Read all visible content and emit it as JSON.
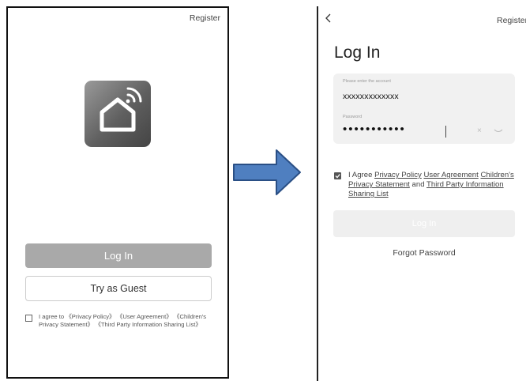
{
  "left_screen": {
    "register_label": "Register",
    "app_icon": "smart-home-icon",
    "login_button": "Log In",
    "guest_button": "Try as Guest",
    "agreement_text": "I agree to 《Privacy Policy》 《User Agreement》 《Children's Privacy Statement》 《Third Party Information Sharing List》",
    "agreement_checked": false
  },
  "arrow": {
    "icon": "right-arrow-icon",
    "fill_color": "#4f7fc0",
    "stroke_color": "#2a4f85"
  },
  "right_screen": {
    "back_icon": "chevron-left-icon",
    "register_label": "Register",
    "title": "Log In",
    "account_label": "Please enter the account",
    "account_value": "xxxxxxxxxxxxx",
    "password_label": "Password",
    "password_value": "•••••••••••",
    "clear_icon": "×",
    "eye_icon": "eye-closed-icon",
    "agreement_checked": true,
    "agreement": {
      "prefix": "I Agree",
      "privacy_policy": "Privacy Policy",
      "user_agreement": "User Agreement",
      "children_privacy": "Children's Privacy Statement",
      "and": "and",
      "third_party": "Third Party Information Sharing List"
    },
    "login_button": "Log In",
    "forgot_password": "Forgot Password"
  }
}
